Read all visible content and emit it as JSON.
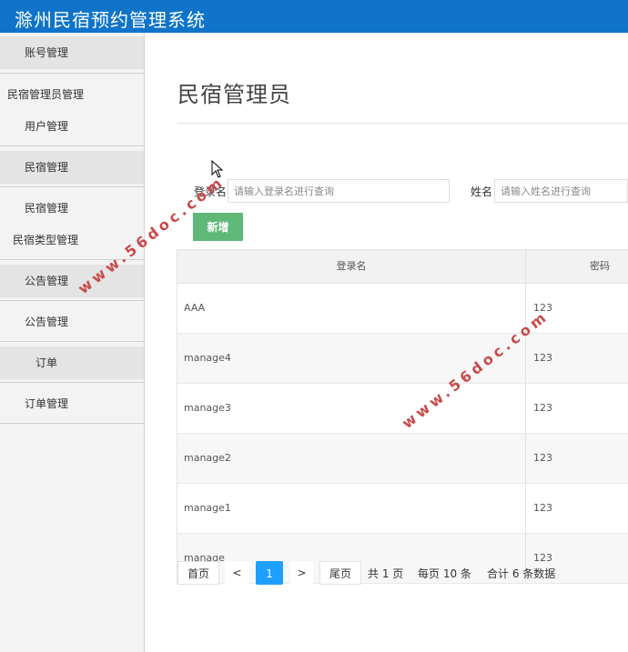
{
  "app": {
    "title": "滁州民宿预约管理系统"
  },
  "sidebar": {
    "items": [
      {
        "label": "账号管理",
        "kind": "group"
      },
      {
        "label": "民宿管理员管理",
        "kind": "item"
      },
      {
        "label": "用户管理",
        "kind": "item"
      },
      {
        "label": "民宿管理",
        "kind": "group"
      },
      {
        "label": "民宿管理",
        "kind": "item"
      },
      {
        "label": "民宿类型管理",
        "kind": "item"
      },
      {
        "label": "公告管理",
        "kind": "group"
      },
      {
        "label": "公告管理",
        "kind": "item"
      },
      {
        "label": "订单",
        "kind": "group"
      },
      {
        "label": "订单管理",
        "kind": "item"
      }
    ]
  },
  "main": {
    "page_title": "民宿管理员",
    "search": {
      "login_label": "登录名",
      "login_placeholder": "请输入登录名进行查询",
      "name_label": "姓名",
      "name_placeholder": "请输入姓名进行查询"
    },
    "add_button": "新增",
    "table": {
      "headers": [
        "登录名",
        "密码"
      ],
      "rows": [
        [
          "AAA",
          "123"
        ],
        [
          "manage4",
          "123"
        ],
        [
          "manage3",
          "123"
        ],
        [
          "manage2",
          "123"
        ],
        [
          "manage1",
          "123"
        ],
        [
          "manage",
          "123"
        ]
      ]
    },
    "pagination": {
      "first": "首页",
      "prev": "<",
      "current": "1",
      "next": ">",
      "last": "尾页",
      "total_pages": "共 1 页",
      "per_page": "每页 10 条",
      "total_records": "合计 6 条数据"
    }
  },
  "watermark": "www.56doc.com",
  "colors": {
    "header_bg": "#0f74c9",
    "add_button": "#5fb878",
    "page_current": "#1e9fff"
  }
}
